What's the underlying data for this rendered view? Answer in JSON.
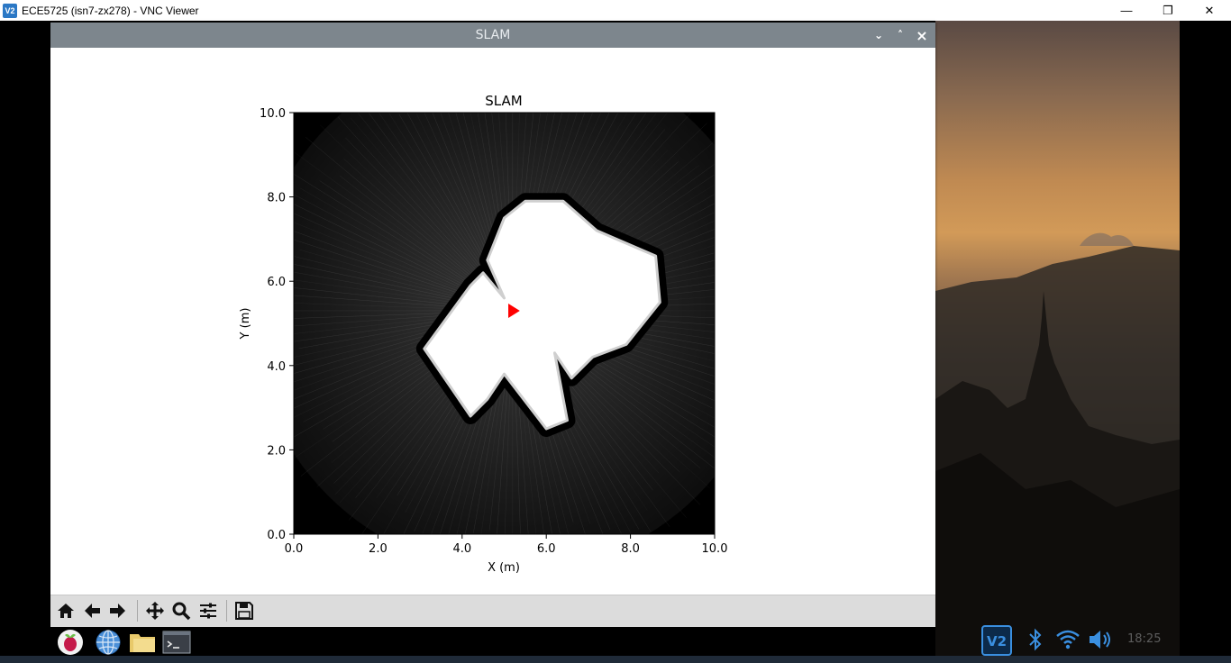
{
  "viewer": {
    "title": "ECE5725 (isn7-zx278) - VNC Viewer",
    "logo_text": "V2",
    "minimize": "—",
    "maximize": "❐",
    "close": "✕"
  },
  "slam_window": {
    "title": "SLAM",
    "btn_shade": "⌄",
    "btn_max": "˄",
    "btn_close": "×"
  },
  "chart_data": {
    "type": "heatmap",
    "title": "SLAM",
    "xlabel": "X (m)",
    "ylabel": "Y (m)",
    "xlim": [
      0,
      10
    ],
    "ylim": [
      0,
      10
    ],
    "xticks": [
      "0.0",
      "2.0",
      "4.0",
      "6.0",
      "8.0",
      "10.0"
    ],
    "yticks": [
      "0.0",
      "2.0",
      "4.0",
      "6.0",
      "8.0",
      "10.0"
    ],
    "grid": false,
    "robot_pose": {
      "x": 5.2,
      "y": 5.3,
      "marker": "red-triangle",
      "color": "#ff0000"
    },
    "free_space_polygon": [
      [
        3.1,
        4.4
      ],
      [
        4.2,
        5.9
      ],
      [
        4.5,
        6.2
      ],
      [
        5.0,
        5.6
      ],
      [
        4.6,
        6.5
      ],
      [
        5.0,
        7.5
      ],
      [
        5.5,
        7.9
      ],
      [
        6.4,
        7.9
      ],
      [
        7.2,
        7.2
      ],
      [
        8.6,
        6.6
      ],
      [
        8.7,
        5.5
      ],
      [
        7.9,
        4.5
      ],
      [
        7.1,
        4.2
      ],
      [
        6.6,
        3.7
      ],
      [
        6.2,
        4.3
      ],
      [
        6.5,
        2.7
      ],
      [
        6.0,
        2.5
      ],
      [
        5.0,
        3.8
      ],
      [
        4.6,
        3.2
      ],
      [
        4.2,
        2.8
      ]
    ]
  },
  "toolbar": {
    "home": "home",
    "back": "back",
    "forward": "forward",
    "pan": "pan",
    "zoom": "zoom",
    "configure": "configure-subplots",
    "save": "save"
  },
  "tray": {
    "clock": "18:25"
  }
}
